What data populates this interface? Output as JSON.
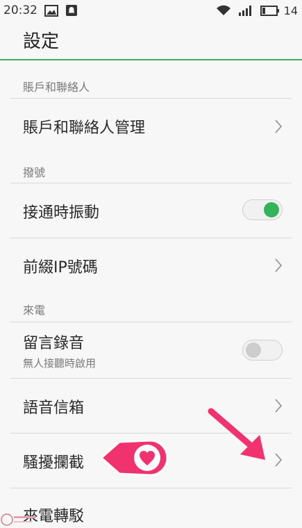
{
  "status_bar": {
    "time": "20:32",
    "battery_text": "14",
    "icons": [
      "image-icon",
      "notification-icon",
      "wifi-icon",
      "signal-icon",
      "battery-icon"
    ]
  },
  "header": {
    "title": "設定"
  },
  "sections": {
    "accounts": {
      "title": "賬戶和聯絡人",
      "items": [
        {
          "label": "賬戶和聯絡人管理"
        }
      ]
    },
    "dialing": {
      "title": "撥號",
      "items": [
        {
          "label": "接通時振動",
          "toggle": true
        },
        {
          "label": "前綴IP號碼"
        }
      ]
    },
    "incoming": {
      "title": "來電",
      "items": [
        {
          "label": "留言錄音",
          "subtitle": "無人接聽時啟用",
          "toggle": false
        },
        {
          "label": "語音信箱"
        },
        {
          "label": "騷擾攔截"
        },
        {
          "label": "來電轉駁"
        }
      ]
    }
  },
  "colors": {
    "accent_green": "#35b35a",
    "annotation_pink": "#f0336f"
  }
}
